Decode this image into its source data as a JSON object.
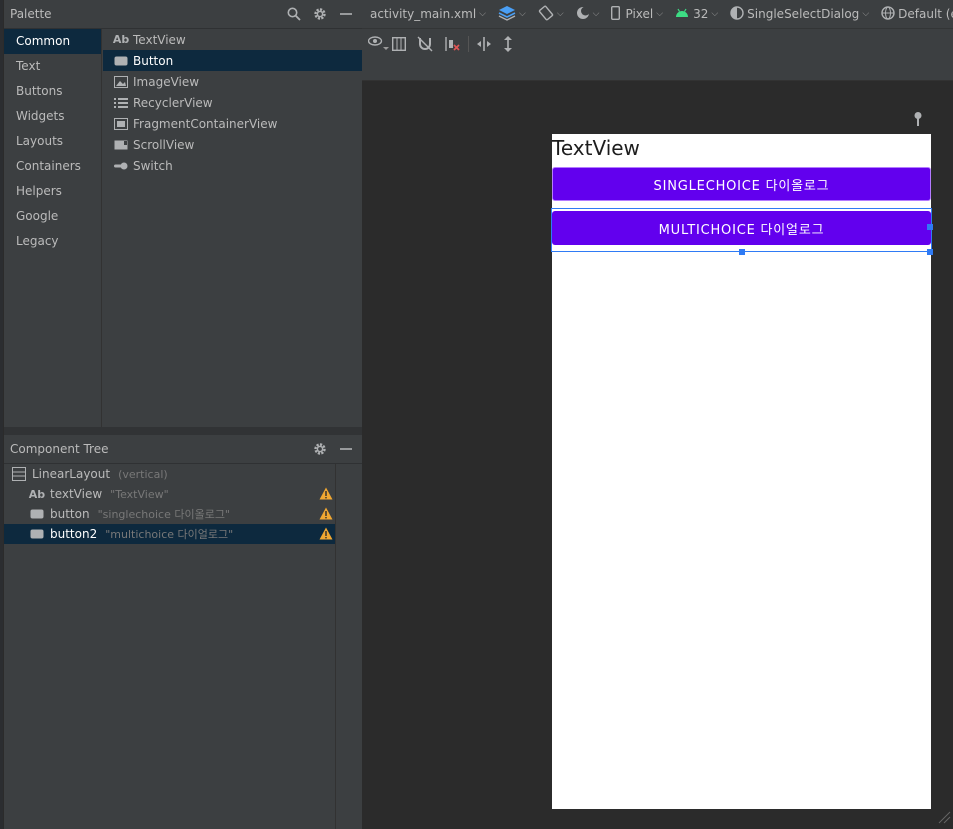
{
  "palette": {
    "title": "Palette",
    "categories": [
      "Common",
      "Text",
      "Buttons",
      "Widgets",
      "Layouts",
      "Containers",
      "Helpers",
      "Google",
      "Legacy"
    ],
    "selected_category": "Common",
    "items": [
      {
        "label": "TextView",
        "icon": "ab-icon"
      },
      {
        "label": "Button",
        "icon": "button-icon"
      },
      {
        "label": "ImageView",
        "icon": "image-icon"
      },
      {
        "label": "RecyclerView",
        "icon": "list-icon"
      },
      {
        "label": "FragmentContainerView",
        "icon": "fragment-icon"
      },
      {
        "label": "ScrollView",
        "icon": "scroll-icon"
      },
      {
        "label": "Switch",
        "icon": "switch-icon"
      }
    ],
    "selected_item": "Button"
  },
  "component_tree": {
    "title": "Component Tree",
    "rows": [
      {
        "label": "LinearLayout",
        "hint": "(vertical)",
        "icon": "linearlayout-icon",
        "warning": false
      },
      {
        "label": "textView",
        "hint": "\"TextView\"",
        "icon": "ab-icon",
        "warning": true
      },
      {
        "label": "button",
        "hint": "\"singlechoice 다이올로그\"",
        "icon": "button-icon",
        "warning": true
      },
      {
        "label": "button2",
        "hint": "\"multichoice 다이얼로그\"",
        "icon": "button-icon",
        "warning": true
      }
    ],
    "selected_row": "button2"
  },
  "toolbar": {
    "file": "activity_main.xml",
    "device": "Pixel",
    "api": "32",
    "theme": "SingleSelectDialog",
    "locale": "Default (en-us)"
  },
  "preview": {
    "textview_text": "TextView",
    "button1_text": "SINGLECHOICE 다이올로그",
    "button2_text": "MULTICHOICE 다이얼로그",
    "button_color": "#6200ee"
  },
  "colors": {
    "selection": "#0d293e",
    "warning": "#f0a732",
    "android_green": "#3ddc84",
    "selection_outline": "#2f7bf5"
  }
}
